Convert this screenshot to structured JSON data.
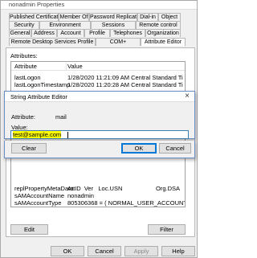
{
  "window": {
    "title": "nonadmin Properties"
  },
  "tabs_row1": [
    "Published Certificates",
    "Member Of",
    "Password Replication",
    "Dial-in",
    "Object"
  ],
  "tabs_row2": [
    "Security",
    "Environment",
    "Sessions",
    "Remote control"
  ],
  "tabs_row3": [
    "General",
    "Address",
    "Account",
    "Profile",
    "Telephones",
    "Organization"
  ],
  "tabs_row4": [
    "Remote Desktop Services Profile",
    "COM+",
    "Attribute Editor"
  ],
  "attributes_label": "Attributes:",
  "columns": {
    "attribute": "Attribute",
    "value": "Value"
  },
  "rows_top": [
    {
      "attr": "lastLogon",
      "value": "1/28/2020 11:21:09 AM Central Standard Ti"
    },
    {
      "attr": "lastLogonTimestamp",
      "value": "1/28/2020 11:20:28 AM Central Standard Ti"
    }
  ],
  "rows_bottom": [
    {
      "attr": "replPropertyMetaData",
      "value": "AttID  Ver   Loc.USN                    Org.DSA"
    },
    {
      "attr": "sAMAccountName",
      "value": "nonadmin"
    },
    {
      "attr": "sAMAccountType",
      "value": "805306368 = ( NORMAL_USER_ACCOUNT"
    }
  ],
  "buttons": {
    "edit": "Edit",
    "filter": "Filter",
    "ok": "OK",
    "cancel": "Cancel",
    "apply": "Apply",
    "help": "Help"
  },
  "dialog": {
    "title": "String Attribute Editor",
    "attribute_label": "Attribute:",
    "attribute_value": "mail",
    "value_label": "Value:",
    "value": "test@sample.com",
    "clear": "Clear",
    "ok": "OK",
    "cancel": "Cancel",
    "close": "×"
  },
  "colors": {
    "highlight": "#ffff00",
    "focus_border": "#0078d7"
  }
}
